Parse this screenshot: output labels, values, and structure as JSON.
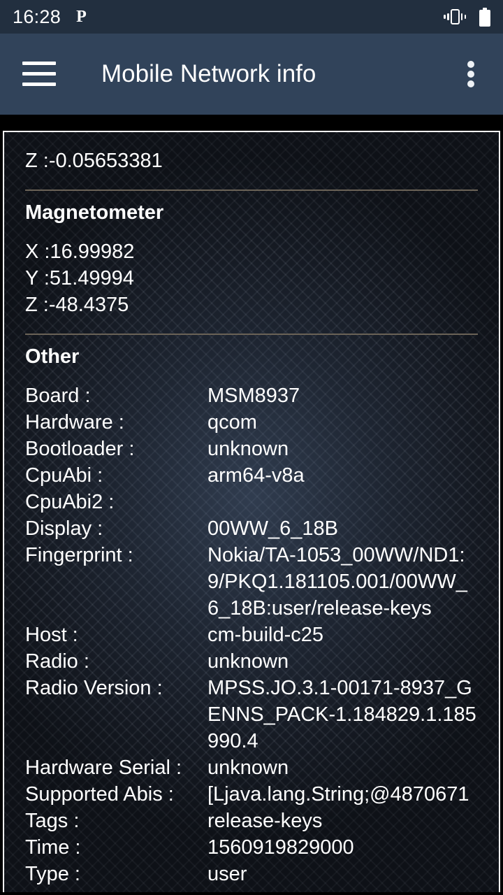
{
  "status_bar": {
    "time": "16:28",
    "notification_glyph": "P",
    "vibrate_icon": "vibrate-icon",
    "battery_icon": "battery-full-icon"
  },
  "app_bar": {
    "menu_icon": "hamburger-menu-icon",
    "title": "Mobile Network info",
    "overflow_icon": "overflow-menu-icon"
  },
  "content": {
    "partial_top_row": "Z :-0.05653381",
    "sections": [
      {
        "title": "Magnetometer",
        "lines": [
          "X :16.99982",
          "Y :51.49994",
          "Z :-48.4375"
        ]
      },
      {
        "title": "Other",
        "rows": [
          {
            "label": "Board :",
            "value": "MSM8937"
          },
          {
            "label": "Hardware :",
            "value": "qcom"
          },
          {
            "label": "Bootloader :",
            "value": "unknown"
          },
          {
            "label": "CpuAbi :",
            "value": "arm64-v8a"
          },
          {
            "label": "CpuAbi2 :",
            "value": ""
          },
          {
            "label": "Display :",
            "value": "00WW_6_18B"
          },
          {
            "label": "Fingerprint :",
            "value": "Nokia/TA-1053_00WW/ND1:9/PKQ1.181105.001/00WW_6_18B:user/release-keys"
          },
          {
            "label": "Host :",
            "value": "cm-build-c25"
          },
          {
            "label": "Radio :",
            "value": "unknown"
          },
          {
            "label": "Radio Version :",
            "value": "MPSS.JO.3.1-00171-8937_GENNS_PACK-1.184829.1.185990.4"
          },
          {
            "label": "Hardware Serial :",
            "value": "unknown"
          },
          {
            "label": "Supported Abis :",
            "value": "[Ljava.lang.String;@4870671"
          },
          {
            "label": "Tags :",
            "value": "release-keys"
          },
          {
            "label": "Time :",
            "value": "1560919829000"
          },
          {
            "label": "Type :",
            "value": "user"
          }
        ]
      }
    ]
  },
  "colors": {
    "status_bar_bg": "#222f3f",
    "app_bar_bg": "#31435a",
    "content_bg": "#1a202b",
    "divider": "#6a6256",
    "text": "#ffffff",
    "card_border": "#ffffff"
  }
}
